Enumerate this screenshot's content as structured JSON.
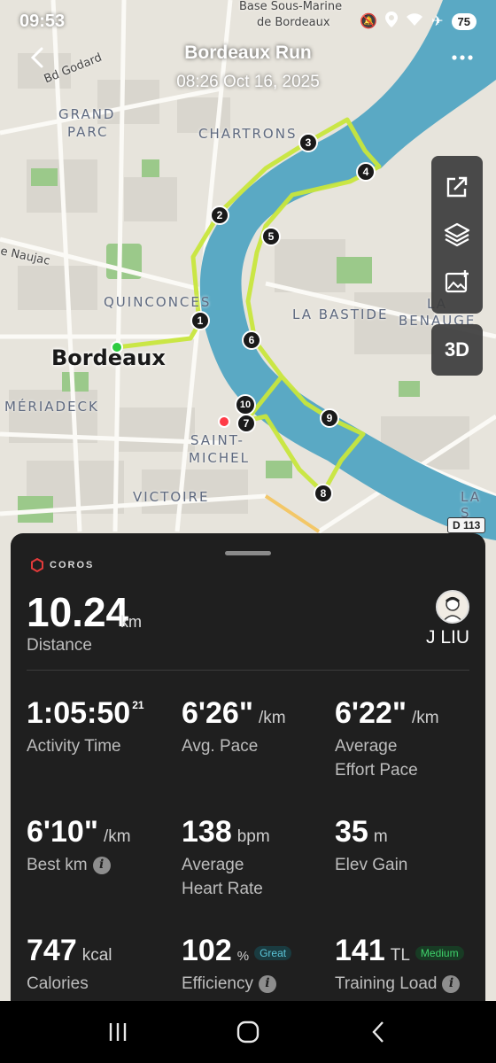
{
  "status": {
    "time": "09:53",
    "battery": "75"
  },
  "header": {
    "title": "Bordeaux Run",
    "subtitle": "08:26 Oct 16, 2025"
  },
  "map": {
    "labels": {
      "grand_parc_1": "GRAND",
      "grand_parc_2": "PARC",
      "chartrons": "CHARTRONS",
      "quinconces": "QUINCONCES",
      "bordeaux": "Bordeaux",
      "meriadeck": "MÉRIADECK",
      "saint_michel_1": "SAINT-",
      "saint_michel_2": "MICHEL",
      "victoire": "VICTOIRE",
      "la_bastide": "LA BASTIDE",
      "la_benauge_1": "LA",
      "la_benauge_2": "BENAUGE",
      "la_s": "LA S",
      "bd_godard": "Bd Godard",
      "naujac": "e Naujac",
      "base_1": "Base Sous-Marine",
      "base_2": "de Bordeaux"
    },
    "road_badge": "D 113",
    "markers": [
      "1",
      "2",
      "3",
      "4",
      "5",
      "6",
      "7",
      "8",
      "9",
      "10"
    ],
    "three_d": "3D"
  },
  "panel": {
    "brand": "COROS",
    "distance": {
      "value": "10.24",
      "unit": "km",
      "label": "Distance"
    },
    "user": {
      "name": "J LIU"
    },
    "stats": {
      "activity_time": {
        "value": "1:05:50",
        "sup": "21",
        "label": "Activity Time"
      },
      "avg_pace": {
        "value": "6'26\"",
        "unit": "/km",
        "label": "Avg. Pace"
      },
      "effort_pace": {
        "value": "6'22\"",
        "unit": "/km",
        "label1": "Average",
        "label2": "Effort Pace"
      },
      "best_km": {
        "value": "6'10\"",
        "unit": "/km",
        "label": "Best km"
      },
      "heart_rate": {
        "value": "138",
        "unit": "bpm",
        "label1": "Average",
        "label2": "Heart Rate"
      },
      "elev_gain": {
        "value": "35",
        "unit": "m",
        "label": "Elev Gain"
      },
      "calories": {
        "value": "747",
        "unit": "kcal",
        "label": "Calories"
      },
      "efficiency": {
        "value": "102",
        "unit": "%",
        "tag": "Great",
        "label": "Efficiency"
      },
      "training_load": {
        "value": "141",
        "unit": "TL",
        "tag": "Medium",
        "label": "Training Load"
      }
    }
  },
  "colors": {
    "route": "#c8e63c",
    "river": "#5aa9c4",
    "start": "#2ecc40",
    "end": "#ff3b47",
    "panel": "#1f1f1f"
  }
}
